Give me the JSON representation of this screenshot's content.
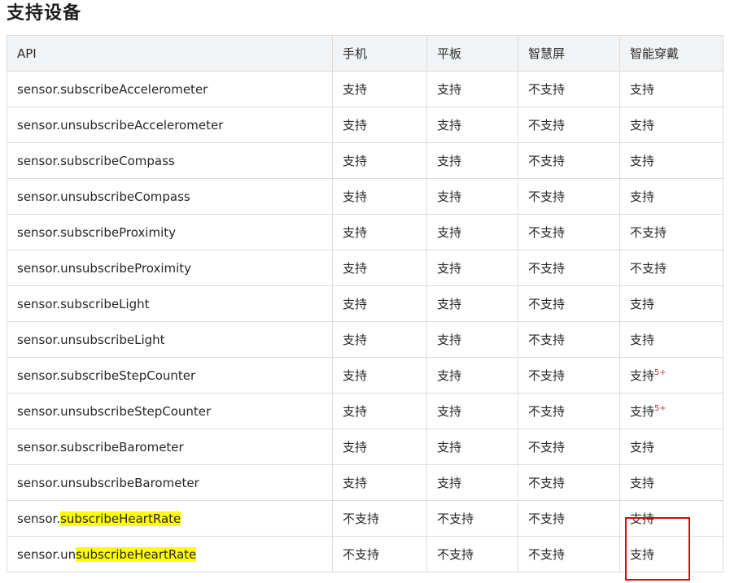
{
  "page_title": "支持设备",
  "table": {
    "headers": [
      "API",
      "手机",
      "平板",
      "智慧屏",
      "智能穿戴"
    ],
    "rows": [
      {
        "api_prefix": "sensor.subscribeAccelerometer",
        "api_hl": "",
        "phone": "支持",
        "tablet": "支持",
        "screen": "不支持",
        "wear": "支持",
        "wear_sup": ""
      },
      {
        "api_prefix": "sensor.unsubscribeAccelerometer",
        "api_hl": "",
        "phone": "支持",
        "tablet": "支持",
        "screen": "不支持",
        "wear": "支持",
        "wear_sup": ""
      },
      {
        "api_prefix": "sensor.subscribeCompass",
        "api_hl": "",
        "phone": "支持",
        "tablet": "支持",
        "screen": "不支持",
        "wear": "支持",
        "wear_sup": ""
      },
      {
        "api_prefix": "sensor.unsubscribeCompass",
        "api_hl": "",
        "phone": "支持",
        "tablet": "支持",
        "screen": "不支持",
        "wear": "支持",
        "wear_sup": ""
      },
      {
        "api_prefix": "sensor.subscribeProximity",
        "api_hl": "",
        "phone": "支持",
        "tablet": "支持",
        "screen": "不支持",
        "wear": "不支持",
        "wear_sup": ""
      },
      {
        "api_prefix": "sensor.unsubscribeProximity",
        "api_hl": "",
        "phone": "支持",
        "tablet": "支持",
        "screen": "不支持",
        "wear": "不支持",
        "wear_sup": ""
      },
      {
        "api_prefix": "sensor.subscribeLight",
        "api_hl": "",
        "phone": "支持",
        "tablet": "支持",
        "screen": "不支持",
        "wear": "支持",
        "wear_sup": ""
      },
      {
        "api_prefix": "sensor.unsubscribeLight",
        "api_hl": "",
        "phone": "支持",
        "tablet": "支持",
        "screen": "不支持",
        "wear": "支持",
        "wear_sup": ""
      },
      {
        "api_prefix": "sensor.subscribeStepCounter",
        "api_hl": "",
        "phone": "支持",
        "tablet": "支持",
        "screen": "不支持",
        "wear": "支持",
        "wear_sup": "5+"
      },
      {
        "api_prefix": "sensor.unsubscribeStepCounter",
        "api_hl": "",
        "phone": "支持",
        "tablet": "支持",
        "screen": "不支持",
        "wear": "支持",
        "wear_sup": "5+"
      },
      {
        "api_prefix": "sensor.subscribeBarometer",
        "api_hl": "",
        "phone": "支持",
        "tablet": "支持",
        "screen": "不支持",
        "wear": "支持",
        "wear_sup": ""
      },
      {
        "api_prefix": "sensor.unsubscribeBarometer",
        "api_hl": "",
        "phone": "支持",
        "tablet": "支持",
        "screen": "不支持",
        "wear": "支持",
        "wear_sup": ""
      },
      {
        "api_prefix": "sensor.",
        "api_hl": "subscribeHeartRate",
        "phone": "不支持",
        "tablet": "不支持",
        "screen": "不支持",
        "wear": "支持",
        "wear_sup": ""
      },
      {
        "api_prefix": "sensor.un",
        "api_hl": "subscribeHeartRate",
        "phone": "不支持",
        "tablet": "不支持",
        "screen": "不支持",
        "wear": "支持",
        "wear_sup": ""
      }
    ]
  },
  "colors": {
    "highlight": "#ffff00",
    "annotation_box": "#e60012",
    "version_superscript": "#c0392b",
    "header_background": "#f1f3f5"
  }
}
